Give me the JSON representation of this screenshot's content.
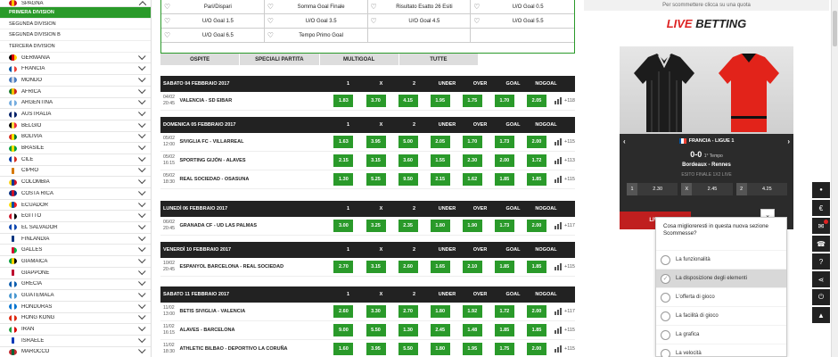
{
  "sidebar": {
    "top": {
      "label": "SPAGNA",
      "flag": [
        "#c60b1e",
        "#ffc400",
        "#c60b1e"
      ]
    },
    "subitems": [
      "PRIMERA DIVISION",
      "SEGUNDA DIVISION",
      "SEGUNDA DIVISION B",
      "TERCERA DIVISION"
    ],
    "countries": [
      {
        "label": "GERMANIA",
        "flag": [
          "#000000",
          "#dd0000",
          "#ffce00"
        ]
      },
      {
        "label": "FRANCIA",
        "flag": [
          "#0055a4",
          "#ffffff",
          "#ef4135"
        ]
      },
      {
        "label": "MONDO",
        "flag": [
          "#4a7bbf",
          "#cfd8e6",
          "#4a7bbf"
        ]
      },
      {
        "label": "AFRICA",
        "flag": [
          "#1a7a2a",
          "#f2c200",
          "#c9231d"
        ]
      },
      {
        "label": "ARGENTINA",
        "flag": [
          "#74acdf",
          "#ffffff",
          "#74acdf"
        ]
      },
      {
        "label": "AUSTRALIA",
        "flag": [
          "#012169",
          "#ffffff",
          "#012169"
        ]
      },
      {
        "label": "BELGIO",
        "flag": [
          "#000000",
          "#fae042",
          "#ed2939"
        ]
      },
      {
        "label": "BOLIVIA",
        "flag": [
          "#d52b1e",
          "#f9e300",
          "#007934"
        ]
      },
      {
        "label": "BRASILE",
        "flag": [
          "#009c3b",
          "#ffdf00",
          "#009c3b"
        ]
      },
      {
        "label": "CILE",
        "flag": [
          "#0039a6",
          "#ffffff",
          "#d52b1e"
        ]
      },
      {
        "label": "CIPRO",
        "flag": [
          "#ffffff",
          "#d57800",
          "#ffffff"
        ]
      },
      {
        "label": "COLOMBIA",
        "flag": [
          "#fcd116",
          "#003893",
          "#ce1126"
        ]
      },
      {
        "label": "COSTA RICA",
        "flag": [
          "#002b7f",
          "#ce1126",
          "#002b7f"
        ]
      },
      {
        "label": "ECUADOR",
        "flag": [
          "#ffdd00",
          "#034ea2",
          "#ed1c24"
        ]
      },
      {
        "label": "EGITTO",
        "flag": [
          "#ce1126",
          "#ffffff",
          "#000000"
        ]
      },
      {
        "label": "EL SALVADOR",
        "flag": [
          "#0f47af",
          "#ffffff",
          "#0f47af"
        ]
      },
      {
        "label": "FINLANDIA",
        "flag": [
          "#ffffff",
          "#003580",
          "#ffffff"
        ]
      },
      {
        "label": "GALLES",
        "flag": [
          "#ffffff",
          "#d30731",
          "#00b140"
        ]
      },
      {
        "label": "GIAMAICA",
        "flag": [
          "#009b3a",
          "#fed100",
          "#000000"
        ]
      },
      {
        "label": "GIAPPONE",
        "flag": [
          "#ffffff",
          "#bc002d",
          "#ffffff"
        ]
      },
      {
        "label": "GRECIA",
        "flag": [
          "#0d5eaf",
          "#ffffff",
          "#0d5eaf"
        ]
      },
      {
        "label": "GUATEMALA",
        "flag": [
          "#4997d0",
          "#ffffff",
          "#4997d0"
        ]
      },
      {
        "label": "HONDURAS",
        "flag": [
          "#0073cf",
          "#ffffff",
          "#0073cf"
        ]
      },
      {
        "label": "HONG KONG",
        "flag": [
          "#de2910",
          "#ffffff",
          "#de2910"
        ]
      },
      {
        "label": "IRAN",
        "flag": [
          "#239f40",
          "#ffffff",
          "#da0000"
        ]
      },
      {
        "label": "ISRAELE",
        "flag": [
          "#ffffff",
          "#0038b8",
          "#ffffff"
        ]
      },
      {
        "label": "MAROCCO",
        "flag": [
          "#c1272d",
          "#006233",
          "#c1272d"
        ]
      }
    ]
  },
  "filters": [
    "Pari/Dispari",
    "Somma Goal Finale",
    "Risultato Esatto 26 Esiti",
    "U/O Goal 0.5",
    "U/O Goal 1.5",
    "U/O Goal 3.5",
    "U/O Goal 4.5",
    "U/O Goal 5.5",
    "U/O Goal 6.5",
    "Tempo Primo Goal"
  ],
  "tabs": [
    "OSPITE",
    "SPECIALI PARTITA",
    "MULTIGOAL",
    "TUTTE"
  ],
  "columns": [
    "1",
    "X",
    "2",
    "UNDER",
    "OVER",
    "GOAL",
    "NOGOAL"
  ],
  "days": [
    {
      "date": "SABATO 04 FEBBRAIO 2017",
      "matches": [
        {
          "d": "04/02",
          "t": "20:45",
          "name": "VALENCIA - SD EIBAR",
          "odds": [
            "1.83",
            "3.70",
            "4.15",
            "1.95",
            "1.75",
            "1.70",
            "2.05"
          ],
          "more": "+118"
        }
      ]
    },
    {
      "date": "DOMENICA 05 FEBBRAIO 2017",
      "matches": [
        {
          "d": "05/02",
          "t": "12:00",
          "name": "SIVIGLIA FC - VILLARREAL",
          "odds": [
            "1.63",
            "3.95",
            "5.00",
            "2.05",
            "1.70",
            "1.73",
            "2.00"
          ],
          "more": "+115"
        },
        {
          "d": "05/02",
          "t": "16:15",
          "name": "SPORTING GIJÓN - ALAVES",
          "odds": [
            "2.15",
            "3.15",
            "3.60",
            "1.55",
            "2.30",
            "2.00",
            "1.72"
          ],
          "more": "+113"
        },
        {
          "d": "05/02",
          "t": "18:30",
          "name": "REAL SOCIEDAD - OSASUNA",
          "odds": [
            "1.30",
            "5.25",
            "9.50",
            "2.15",
            "1.62",
            "1.85",
            "1.85"
          ],
          "more": "+115"
        }
      ]
    },
    {
      "date": "LUNEDÌ 06 FEBBRAIO 2017",
      "matches": [
        {
          "d": "06/02",
          "t": "20:45",
          "name": "GRANADA CF - UD LAS PALMAS",
          "odds": [
            "3.00",
            "3.25",
            "2.35",
            "1.80",
            "1.90",
            "1.73",
            "2.00"
          ],
          "more": "+117"
        }
      ]
    },
    {
      "date": "VENERDÌ 10 FEBBRAIO 2017",
      "matches": [
        {
          "d": "10/02",
          "t": "20:45",
          "name": "ESPANYOL BARCELONA - REAL SOCIEDAD",
          "odds": [
            "2.70",
            "3.15",
            "2.60",
            "1.65",
            "2.10",
            "1.85",
            "1.85"
          ],
          "more": "+115"
        }
      ]
    },
    {
      "date": "SABATO 11 FEBBRAIO 2017",
      "matches": [
        {
          "d": "11/02",
          "t": "13:00",
          "name": "BETIS SIVIGLIA - VALENCIA",
          "odds": [
            "2.60",
            "3.30",
            "2.70",
            "1.80",
            "1.92",
            "1.72",
            "2.00"
          ],
          "more": "+117"
        },
        {
          "d": "11/02",
          "t": "16:15",
          "name": "ALAVES - BARCELONA",
          "odds": [
            "9.00",
            "5.50",
            "1.30",
            "2.45",
            "1.48",
            "1.85",
            "1.85"
          ],
          "more": "+115"
        },
        {
          "d": "11/02",
          "t": "18:30",
          "name": "ATHLETIC BILBAO - DEPORTIVO LA CORUÑA",
          "odds": [
            "1.60",
            "3.95",
            "5.50",
            "1.80",
            "1.95",
            "1.75",
            "2.00"
          ],
          "more": "+115"
        }
      ]
    }
  ],
  "right": {
    "tip": "Per scommettere clicca su una quota",
    "live_word1": "LIVE",
    "live_word2": " BETTING",
    "league": "FRANCIA - LIGUE 1",
    "score": "0-0",
    "period": "1° Tempo",
    "teams": "Bordeaux - Rennes",
    "market": "ESITO FINALE 1X2 LIVE",
    "quotes": [
      {
        "k": "1",
        "v": "2.30"
      },
      {
        "k": "X",
        "v": "2.45"
      },
      {
        "k": "2",
        "v": "4.25"
      }
    ],
    "live_button": "LIVE"
  },
  "survey": {
    "question": "Cosa miglioreresti in questa nuova sezione Scommesse?",
    "options": [
      "La funzionalità",
      "La disposizione degli elementi",
      "L'offerta di gioco",
      "La facilità di gioco",
      "La grafica",
      "La velocità"
    ],
    "selected": 1
  },
  "toolbar": [
    "user-icon",
    "euro-icon",
    "mail-icon",
    "phone-icon",
    "help-icon",
    "share-icon",
    "power-icon",
    "up-arrow-icon"
  ],
  "colors": {
    "accent": "#2a9a2a",
    "live": "#d22222",
    "dark": "#222222"
  }
}
